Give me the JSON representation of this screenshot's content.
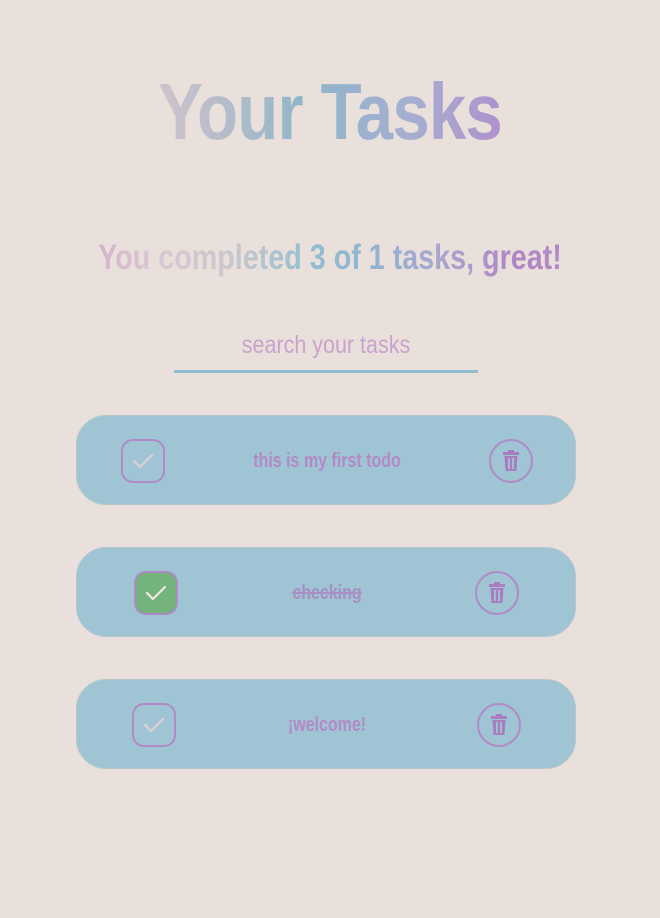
{
  "header": {
    "title": "Your Tasks",
    "summary": "You completed 3 of 1 tasks, great!"
  },
  "search": {
    "placeholder": "search your tasks",
    "value": ""
  },
  "tasks": [
    {
      "label": "this is my first todo",
      "completed": false
    },
    {
      "label": "checking",
      "completed": true
    },
    {
      "label": "¡welcome!",
      "completed": false
    }
  ],
  "icons": {
    "check": "check-icon",
    "delete": "trash-icon"
  },
  "colors": {
    "background": "#e9e0db",
    "card": "#9fc4d3",
    "accent": "#b08ac6",
    "done_check": "#74b37c",
    "search_underline": "#8fbfce"
  }
}
